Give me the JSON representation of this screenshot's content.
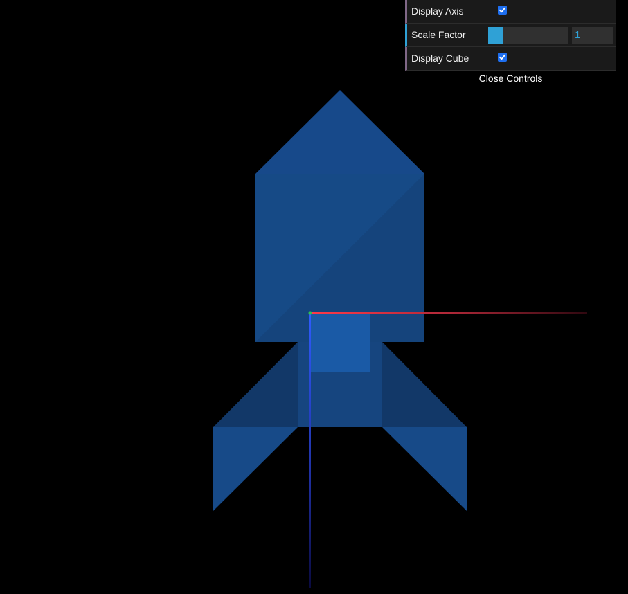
{
  "controls": {
    "display_axis": {
      "label": "Display Axis",
      "checked": true
    },
    "scale_factor": {
      "label": "Scale Factor",
      "value": "1",
      "fraction": 0.18
    },
    "display_cube": {
      "label": "Display Cube",
      "checked": true
    },
    "close_label": "Close Controls"
  },
  "scene": {
    "background": "#000000",
    "mesh_color": "#1a4f8f",
    "axes": {
      "x_color": "#e03040",
      "y_color": "#30c050",
      "z_color": "#2040d0"
    }
  }
}
